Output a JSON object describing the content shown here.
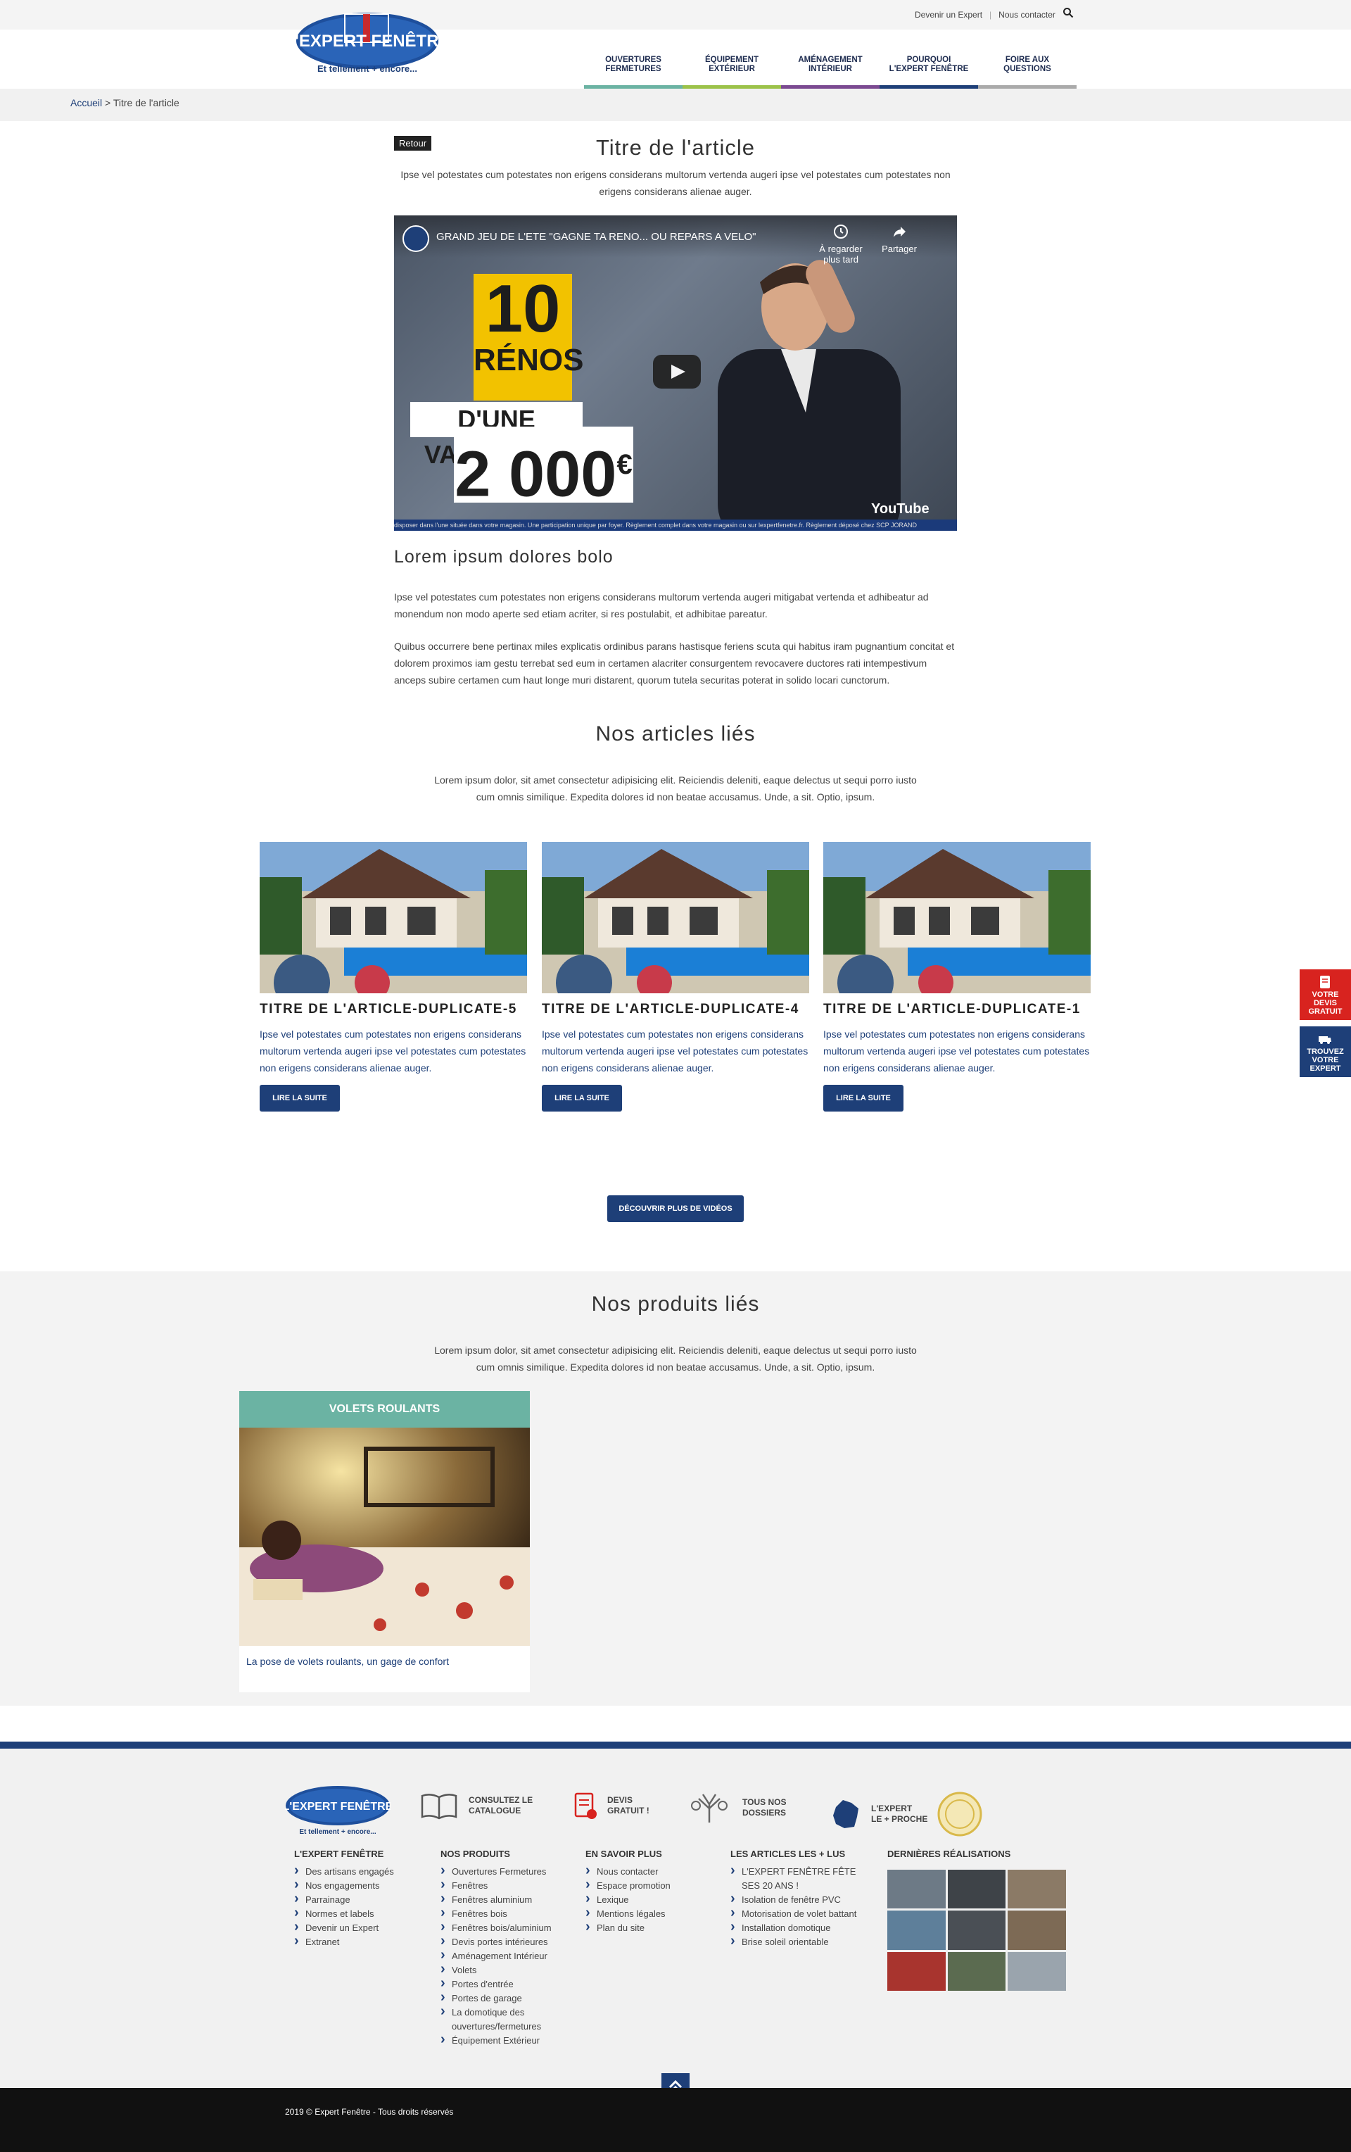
{
  "header": {
    "top_links": [
      "Devenir un Expert",
      "Nous contacter"
    ],
    "logo_text": "L'EXPERT FENÊTRE",
    "logo_tagline": "Et tellement + encore...",
    "nav": [
      {
        "line1": "Ouvertures",
        "line2": "Fermetures",
        "color": "#6bb3a3"
      },
      {
        "line1": "Équipement",
        "line2": "Extérieur",
        "color": "#9cc24a"
      },
      {
        "line1": "Aménagement",
        "line2": "Intérieur",
        "color": "#7b4a91"
      },
      {
        "line1": "Pourquoi",
        "line2": "L'Expert Fenêtre",
        "color": "#1e3f78"
      },
      {
        "line1": "Foire aux",
        "line2": "questions",
        "color": "#aaaaaa"
      }
    ]
  },
  "breadcrumb": {
    "home": "Accueil",
    "sep": ">",
    "current": "Titre de l'article"
  },
  "article": {
    "back_label": "Retour",
    "title": "Titre de l'article",
    "intro": "Ipse vel potestates cum potestates non erigens considerans multorum vertenda augeri ipse vel potestates cum potestates non erigens considerans alienae auger.",
    "video": {
      "title": "GRAND JEU DE L'ETE \"GAGNE TA RENO... OU REPARS A VELO\"",
      "watch_later": "À regarder plus tard",
      "share": "Partager",
      "big_number": "10",
      "big_word": "RÉNOS",
      "value_text": "D'UNE VALEUR DE",
      "amount": "2 000",
      "currency": "€",
      "brand": "YouTube",
      "footer": "disposer dans l'une située dans votre magasin. Une participation unique par foyer. Règlement complet dans votre magasin ou sur lexpertfenetre.fr. Règlement déposé chez SCP JORAND"
    },
    "subtitle": "Lorem ipsum dolores bolo",
    "paragraphs": [
      "Ipse vel potestates cum potestates non erigens considerans multorum vertenda augeri mitigabat vertenda et adhibeatur ad monendum non modo aperte sed etiam acriter, si res postulabit, et adhibitae pareatur.",
      "Quibus occurrere bene pertinax miles explicatis ordinibus parans hastisque feriens scuta qui habitus iram pugnantium concitat et dolorem proximos iam gestu terrebat sed eum in certamen alacriter consurgentem revocavere ductores rati intempestivum anceps subire certamen cum haut longe muri distarent, quorum tutela securitas poterat in solido locari cunctorum."
    ]
  },
  "related_articles": {
    "heading": "Nos articles liés",
    "lead": "Lorem ipsum dolor, sit amet consectetur adipisicing elit. Reiciendis deleniti, eaque delectus ut sequi porro iusto cum omnis similique. Expedita dolores id non beatae accusamus. Unde, a sit. Optio, ipsum.",
    "cards": [
      {
        "title": "Titre de l'article-duplicate-5",
        "text": "Ipse vel potestates cum potestates non erigens considerans multorum vertenda augeri ipse vel potestates cum potestates non erigens considerans alienae auger.",
        "button": "Lire la suite"
      },
      {
        "title": "Titre de l'article-duplicate-4",
        "text": "Ipse vel potestates cum potestates non erigens considerans multorum vertenda augeri ipse vel potestates cum potestates non erigens considerans alienae auger.",
        "button": "Lire la suite"
      },
      {
        "title": "Titre de l'article-duplicate-1",
        "text": "Ipse vel potestates cum potestates non erigens considerans multorum vertenda augeri ipse vel potestates cum potestates non erigens considerans alienae auger.",
        "button": "Lire la suite"
      }
    ],
    "more_button": "Découvrir plus de vidéos"
  },
  "related_products": {
    "heading": "Nos produits liés",
    "lead": "Lorem ipsum dolor, sit amet consectetur adipisicing elit. Reiciendis deleniti, eaque delectus ut sequi porro iusto cum omnis similique. Expedita dolores id non beatae accusamus. Unde, a sit. Optio, ipsum.",
    "product": {
      "category": "Volets roulants",
      "caption": "La pose de volets roulants, un gage de confort"
    }
  },
  "side_buttons": [
    {
      "line1": "Votre",
      "line2": "devis",
      "line3": "gratuit"
    },
    {
      "line1": "Trouvez",
      "line2": "votre",
      "line3": "expert"
    }
  ],
  "footer": {
    "badges": [
      {
        "line1": "Consultez le",
        "line2": "catalogue"
      },
      {
        "line1": "Devis",
        "line2": "gratuit !"
      },
      {
        "line1": "Tous nos",
        "line2": "dossiers"
      },
      {
        "line1": "L'Expert",
        "line2": "le + proche"
      }
    ],
    "columns": [
      {
        "title": "L'Expert Fenêtre",
        "items": [
          "Des artisans engagés",
          "Nos engagements",
          "Parrainage",
          "Normes et labels",
          "Devenir un Expert",
          "Extranet"
        ]
      },
      {
        "title": "Nos produits",
        "items": [
          "Ouvertures Fermetures",
          "Fenêtres",
          "Fenêtres aluminium",
          "Fenêtres bois",
          "Fenêtres bois/aluminium",
          "Devis portes intérieures",
          "Aménagement Intérieur",
          "Volets",
          "Portes d'entrée",
          "Portes de garage",
          "La domotique des ouvertures/fermetures",
          "Équipement Extérieur"
        ]
      },
      {
        "title": "En savoir plus",
        "items": [
          "Nous contacter",
          "Espace promotion",
          "Lexique",
          "Mentions légales",
          "Plan du site"
        ]
      },
      {
        "title": "Les articles les + lus",
        "items": [
          "L'EXPERT FENÊTRE FÊTE SES 20 ANS !",
          "Isolation de fenêtre PVC",
          "Motorisation de volet battant",
          "Installation domotique",
          "Brise soleil orientable"
        ]
      }
    ],
    "gallery_title": "Dernières réalisations",
    "copyright": "2019 © Expert Fenêtre - Tous droits réservés"
  }
}
